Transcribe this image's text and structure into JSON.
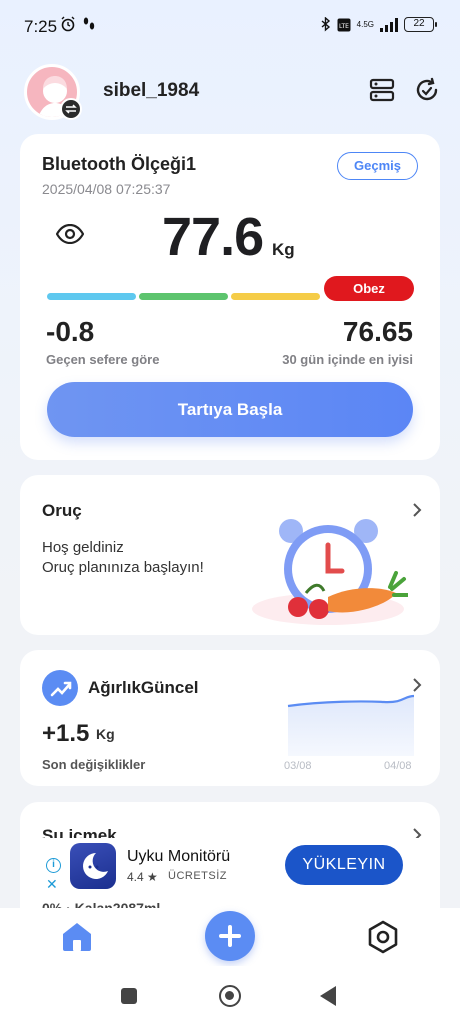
{
  "status_bar": {
    "time": "7:25",
    "network": "4.5G",
    "battery": "22"
  },
  "header": {
    "username": "sibel_1984",
    "icons": [
      "avatar",
      "switch-account-icon",
      "device-list-icon",
      "refresh-icon"
    ]
  },
  "scale_card": {
    "device_name": "Bluetooth Ölçeği1",
    "history_label": "Geçmiş",
    "timestamp": "2025/04/08 07:25:37",
    "weight": "77.6",
    "unit": "Kg",
    "status_badge": "Obez",
    "bar_colors": [
      "#5ec8ef",
      "#5dc46e",
      "#f5cc47",
      "#e0181e"
    ],
    "change_value": "-0.8",
    "change_label": "Geçen sefere göre",
    "best_value": "76.65",
    "best_label": "30 gün içinde en iyisi",
    "start_button": "Tartıya Başla"
  },
  "fasting_card": {
    "title": "Oruç",
    "line1": "Hoş geldiniz",
    "line2": "Oruç planınıza başlayın!"
  },
  "weight_card": {
    "title": "AğırlıkGüncel",
    "delta": "+1.5",
    "unit": "Kg",
    "label": "Son değişiklikler",
    "date_start": "03/08",
    "date_end": "04/08"
  },
  "water_card": {
    "title": "Su içmek",
    "progress": "0% · Kalan2087ml"
  },
  "ad": {
    "app_name": "Uyku Monitörü",
    "rating": "4.4 ★",
    "price": "ÜCRETSİZ",
    "install_label": "YÜKLEYIN",
    "info_label": "i",
    "close_label": "✕"
  },
  "bottom_nav": {
    "items": [
      "home-icon",
      "add-icon",
      "settings-icon"
    ]
  }
}
